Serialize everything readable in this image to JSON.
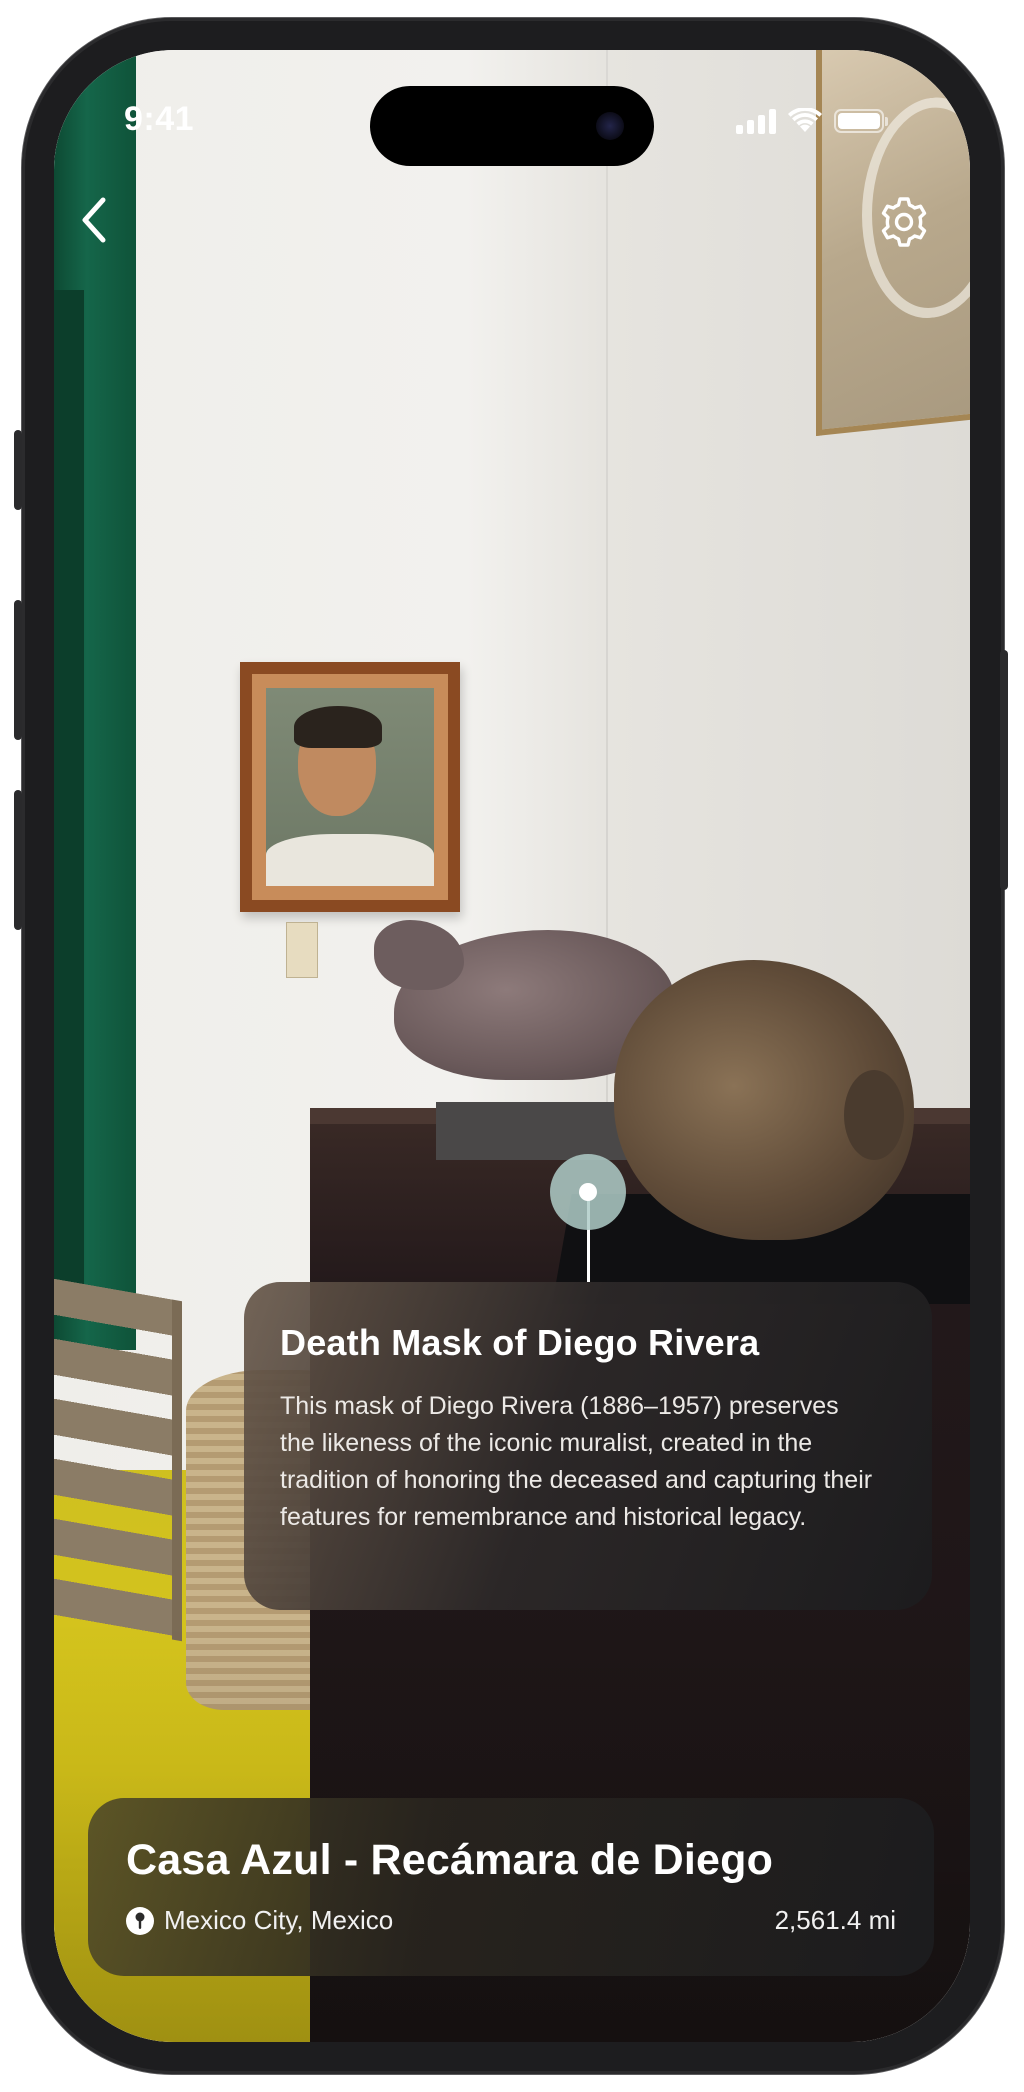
{
  "status_bar": {
    "time": "9:41"
  },
  "nav": {
    "back_icon": "chevron-left-icon",
    "settings_icon": "gear-icon"
  },
  "hotspot": {
    "icon": "hotspot-pin-icon",
    "color": "#AFCDC8"
  },
  "info_card": {
    "title": "Death Mask of Diego Rivera",
    "body": "This mask of Diego Rivera (1886–1957) preserves the likeness of the iconic muralist, created in the tradition of honoring the deceased and capturing their features for remembrance and historical legacy."
  },
  "location_card": {
    "title": "Casa Azul - Recámara de Diego",
    "location": "Mexico City, Mexico",
    "distance": "2,561.4 mi",
    "pin_icon": "location-pin-icon"
  },
  "colors": {
    "accent": "#AFCDC8",
    "card_text": "#FFFFFF"
  }
}
